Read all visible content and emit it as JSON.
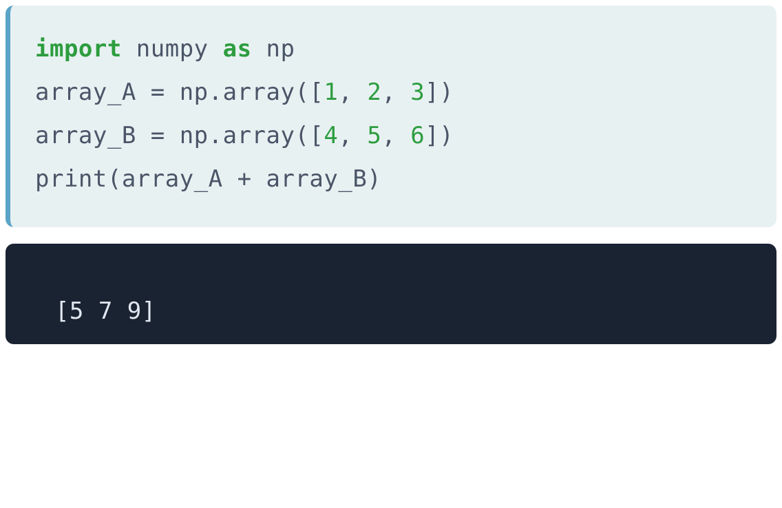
{
  "code": {
    "line1_import": "import",
    "line1_module": " numpy ",
    "line1_as": "as",
    "line1_alias": " np",
    "blank": "",
    "line3_prefix": "array_A = np.array([",
    "line3_n1": "1",
    "line3_c1": ", ",
    "line3_n2": "2",
    "line3_c2": ", ",
    "line3_n3": "3",
    "line3_suffix": "])",
    "line4_prefix": "array_B = np.array([",
    "line4_n1": "4",
    "line4_c1": ", ",
    "line4_n2": "5",
    "line4_c2": ", ",
    "line4_n3": "6",
    "line4_suffix": "])",
    "line6": "print(array_A + array_B)"
  },
  "output": "[5 7 9]"
}
